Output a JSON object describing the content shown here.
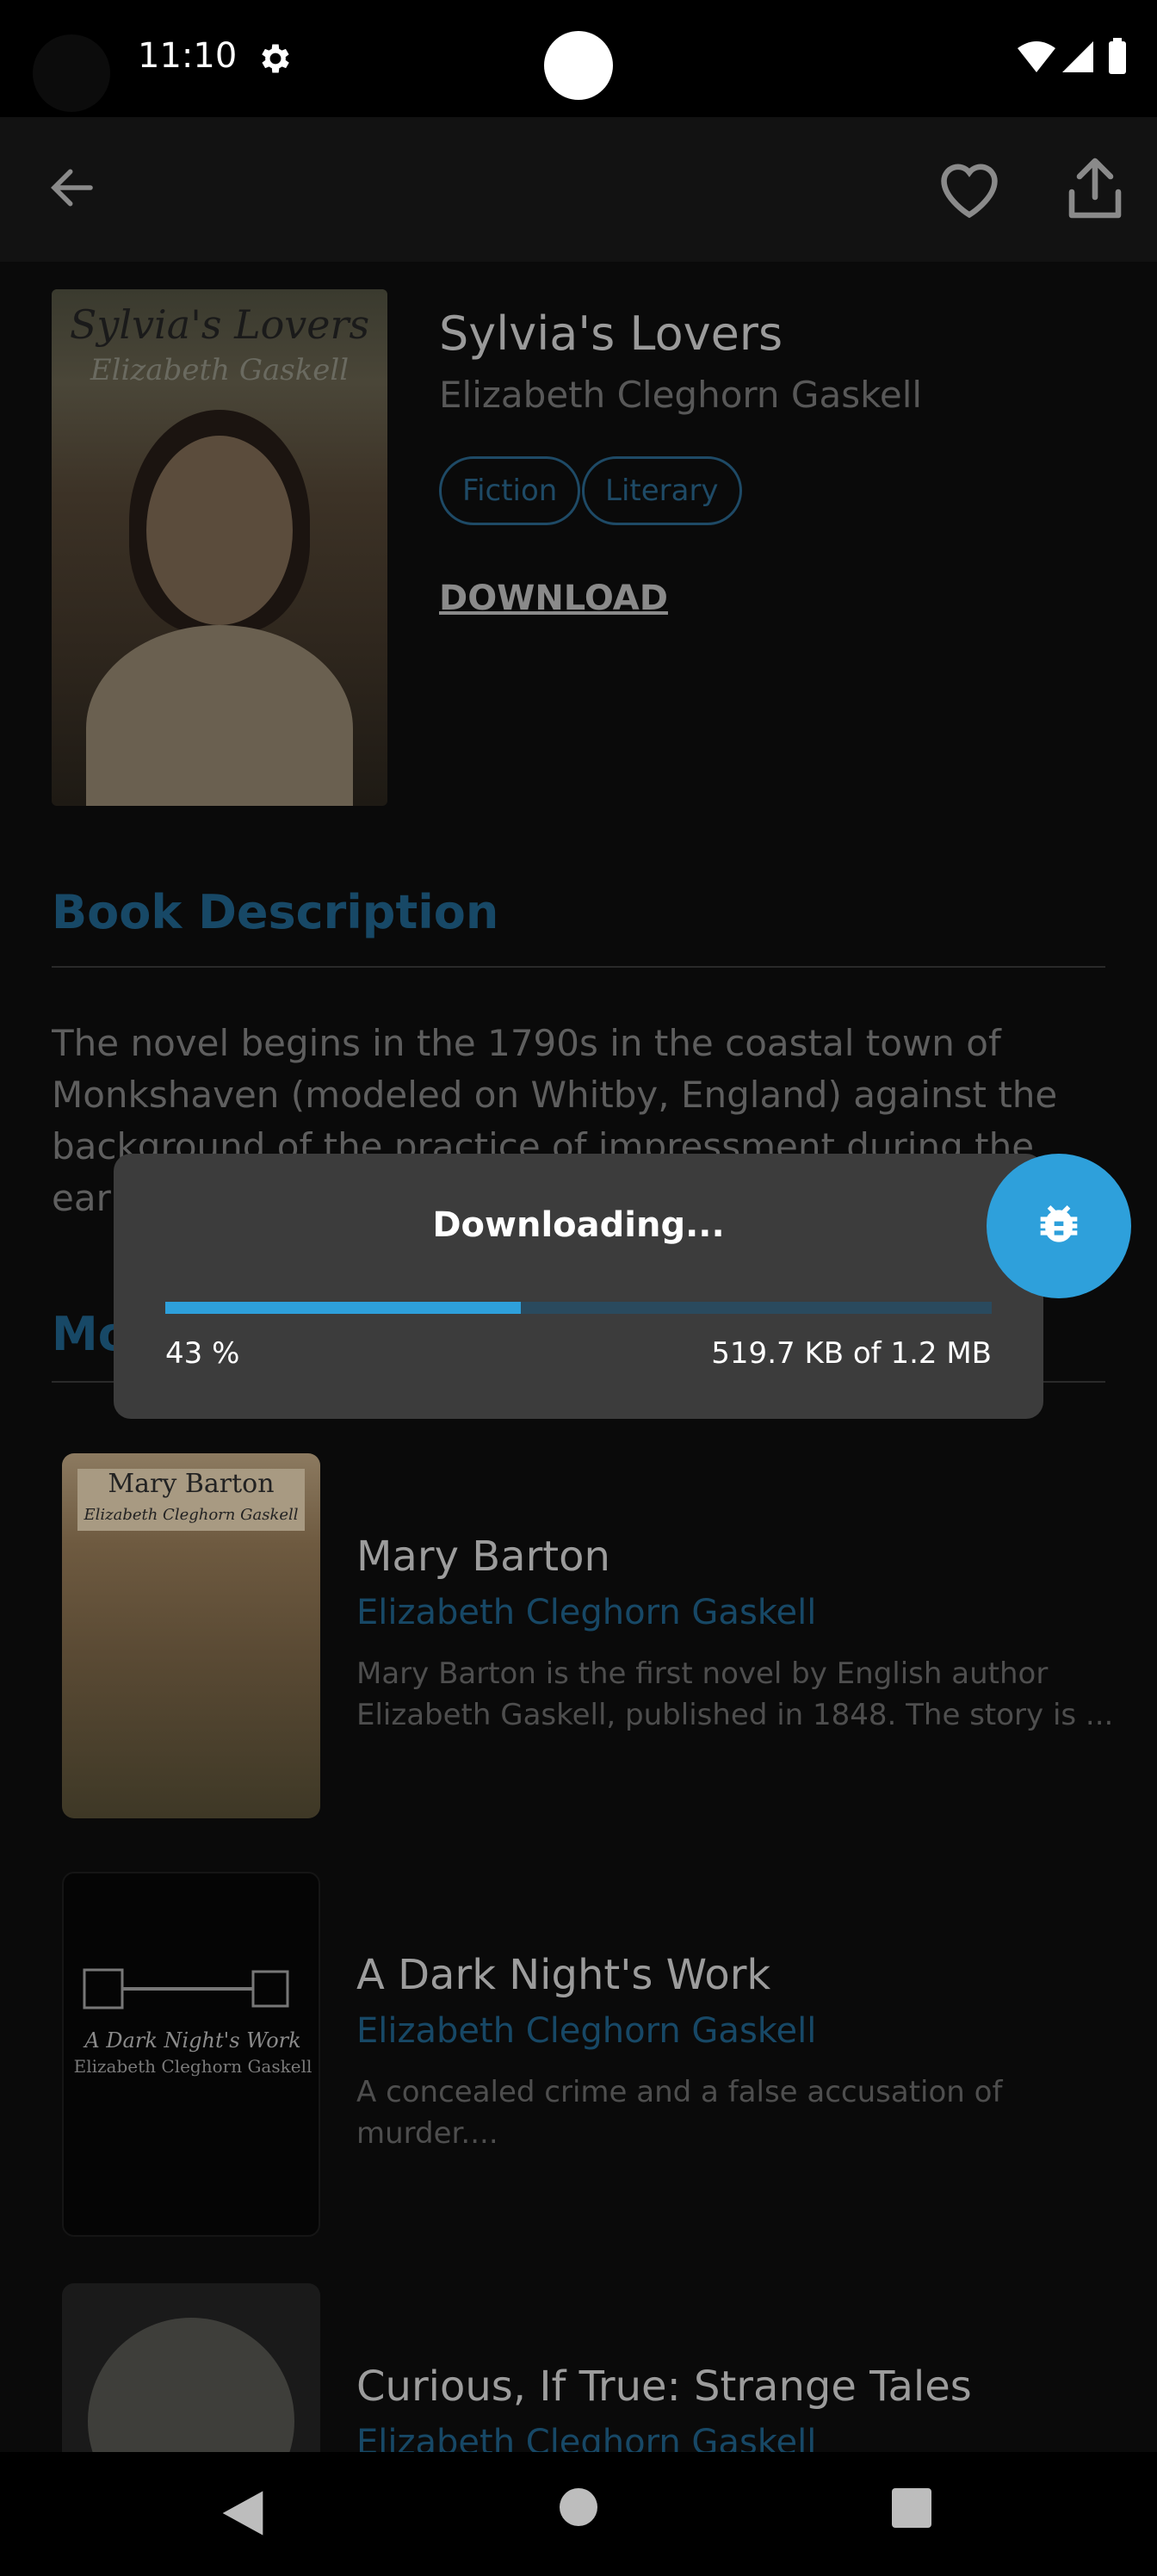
{
  "status_bar": {
    "time": "11:10",
    "icons": [
      "settings-icon",
      "wifi-icon",
      "signal-icon",
      "battery-icon"
    ]
  },
  "app_bar": {
    "icons": [
      "back-arrow-icon",
      "heart-icon",
      "share-icon"
    ]
  },
  "book": {
    "cover_title": "Sylvia's Lovers",
    "cover_author": "Elizabeth Gaskell",
    "title": "Sylvia's Lovers",
    "author": "Elizabeth Cleghorn Gaskell",
    "tags": [
      "Fiction",
      "Literary"
    ],
    "download_label": "DOWNLOAD"
  },
  "description": {
    "heading": "Book Description",
    "text": "The novel begins in the 1790s in the coastal town of Monkshaven (modeled on Whitby, England) against the background of the practice of impressment during the early pha"
  },
  "more": {
    "heading": "Mo",
    "books": [
      {
        "title": "Mary Barton",
        "author": "Elizabeth Cleghorn Gaskell",
        "desc": "Mary Barton is the first novel by English author Elizabeth Gaskell, published in 1848. The story is ...",
        "cover_title": "Mary Barton",
        "cover_author": "Elizabeth Cleghorn Gaskell"
      },
      {
        "title": "A Dark Night's Work",
        "author": "Elizabeth Cleghorn Gaskell",
        "desc": "A concealed crime and a false accusation of murder....",
        "cover_title": "A Dark Night's Work",
        "cover_author": "Elizabeth Cleghorn Gaskell"
      },
      {
        "title": "Curious, If True: Strange Tales",
        "author": "Elizabeth Cleghorn Gaskell",
        "desc": ""
      }
    ]
  },
  "download_dialog": {
    "title": "Downloading...",
    "progress_percent": 43,
    "percent_label": "43 %",
    "size_label": "519.7 KB of 1.2 MB"
  },
  "fab": {
    "icon": "bug-icon"
  },
  "colors": {
    "accent": "#2ea0db",
    "dialog_bg": "#3c3c3c",
    "background": "#000000"
  }
}
